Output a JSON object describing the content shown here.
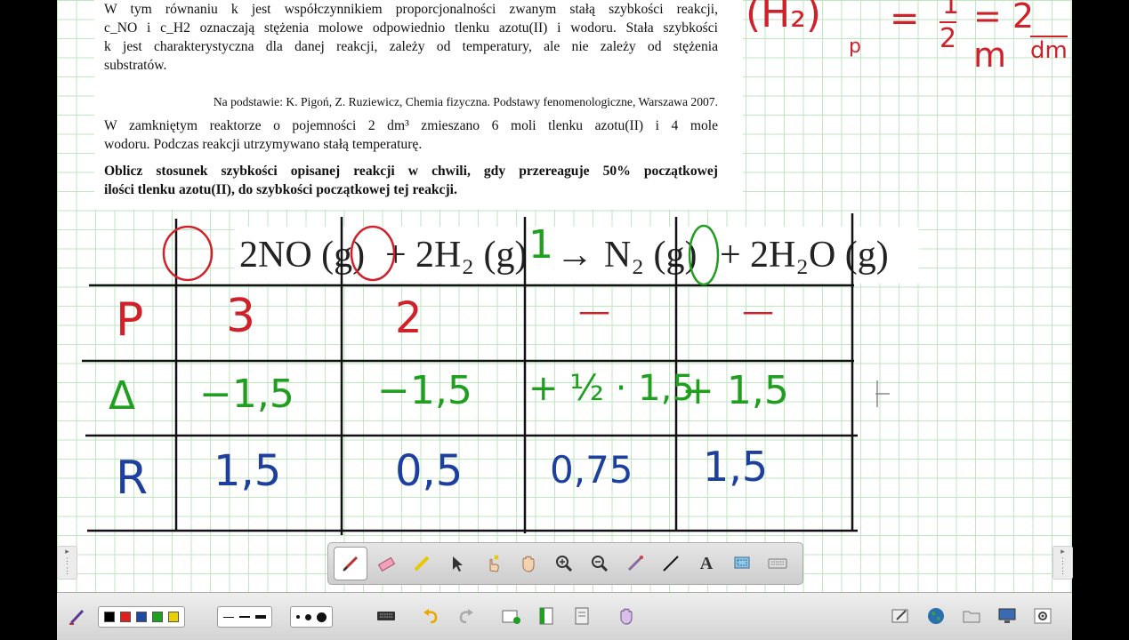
{
  "document": {
    "para1": [
      "W tym równaniu k jest współczynnikiem proporcjonalności zwanym stałą szybkości reakcji,",
      "c_NO i c_H2 oznaczają stężenia molowe odpowiednio tlenku azotu(II) i wodoru. Stała szybkości",
      "k jest charakterystyczna dla danej reakcji, zależy od temperatury, ale nie zależy od stężenia",
      "substratów."
    ],
    "source": "Na podstawie: K. Pigoń, Z. Ruziewicz, Chemia fizyczna. Podstawy fenomenologiczne, Warszawa 2007.",
    "para2": [
      "W zamkniętym reaktorze o pojemności 2 dm³ zmieszano 6 moli tlenku azotu(II) i 4 mole",
      "wodoru. Podczas reakcji utrzymywano stałą temperaturę."
    ],
    "task": [
      "Oblicz stosunek szybkości opisanej reakcji w chwili, gdy przereaguje 50% początkowej",
      "ilości tlenku azotu(II), do szybkości początkowej tej reakcji."
    ]
  },
  "equation": {
    "no": "2NO (g)",
    "plus1": "+",
    "h2": "2H₂ (g)",
    "arrow": "→",
    "n2": "N₂ (g)",
    "plus2": "+",
    "h2o": "2H₂O (g)"
  },
  "annotations": {
    "one_coef": "1",
    "top_right": [
      "(H₂)",
      "p",
      "=",
      "1",
      "2",
      "= 2 m",
      "dm"
    ],
    "rows": [
      {
        "label": "P",
        "color": "#d0202a",
        "cells": [
          "3",
          "2",
          "—",
          "—"
        ]
      },
      {
        "label": "Δ",
        "color": "#1f9e1f",
        "cells": [
          "−1,5",
          "−1,5",
          "+ ½ · 1,5",
          "+ 1,5"
        ]
      },
      {
        "label": "R",
        "color": "#1d3f9e",
        "cells": [
          "1,5",
          "0,5",
          "0,75",
          "1,5"
        ]
      }
    ]
  },
  "colors": {
    "red": "#d0202a",
    "green": "#1f9e1f",
    "blue": "#1d3f9e",
    "grid": "#bfe6bf"
  },
  "toolbar": {
    "tools": [
      "pen-icon",
      "eraser-icon",
      "highlighter-icon",
      "select-arrow-icon",
      "pointer-hand-icon",
      "pan-hand-icon",
      "zoom-in-icon",
      "zoom-out-icon",
      "magic-pen-icon",
      "line-icon",
      "text-recognition-icon",
      "screen-capture-icon",
      "keyboard-icon"
    ],
    "text_tool_label": "A",
    "swatches": [
      "#000000",
      "#e02020",
      "#1e4aa0",
      "#20a020",
      "#e8d000"
    ]
  }
}
